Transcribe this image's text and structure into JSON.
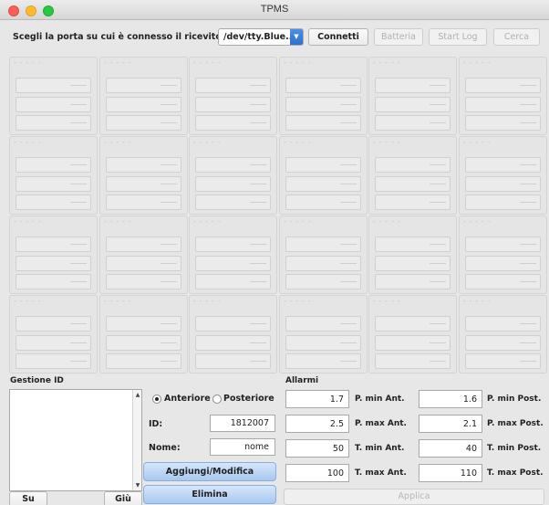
{
  "window": {
    "title": "TPMS"
  },
  "toolbar": {
    "port_label": "Scegli la porta su cui è connesso il ricevitore",
    "port_value": "/dev/tty.Blue...",
    "connect_label": "Connetti",
    "battery_label": "Batteria",
    "start_log_label": "Start Log",
    "search_label": "Cerca"
  },
  "sensors": {
    "cell_title": "- - - - -"
  },
  "gestione_id": {
    "title": "Gestione ID",
    "up_label": "Su",
    "down_label": "Giù",
    "radio_front": "Anteriore",
    "radio_rear": "Posteriore",
    "selected": "Anteriore",
    "id_label": "ID:",
    "id_value": "1812007",
    "name_label": "Nome:",
    "name_value": "nome",
    "add_label": "Aggiungi/Modifica",
    "delete_label": "Elimina"
  },
  "alarms": {
    "title": "Allarmi",
    "rows": [
      {
        "left_value": "1.7",
        "left_label": "P. min Ant.",
        "right_value": "1.6",
        "right_label": "P. min Post."
      },
      {
        "left_value": "2.5",
        "left_label": "P. max Ant.",
        "right_value": "2.1",
        "right_label": "P. max Post."
      },
      {
        "left_value": "50",
        "left_label": "T. min Ant.",
        "right_value": "40",
        "right_label": "T. min Post."
      },
      {
        "left_value": "100",
        "left_label": "T. max Ant.",
        "right_value": "110",
        "right_label": "T. max Post."
      }
    ],
    "apply_label": "Applica"
  }
}
